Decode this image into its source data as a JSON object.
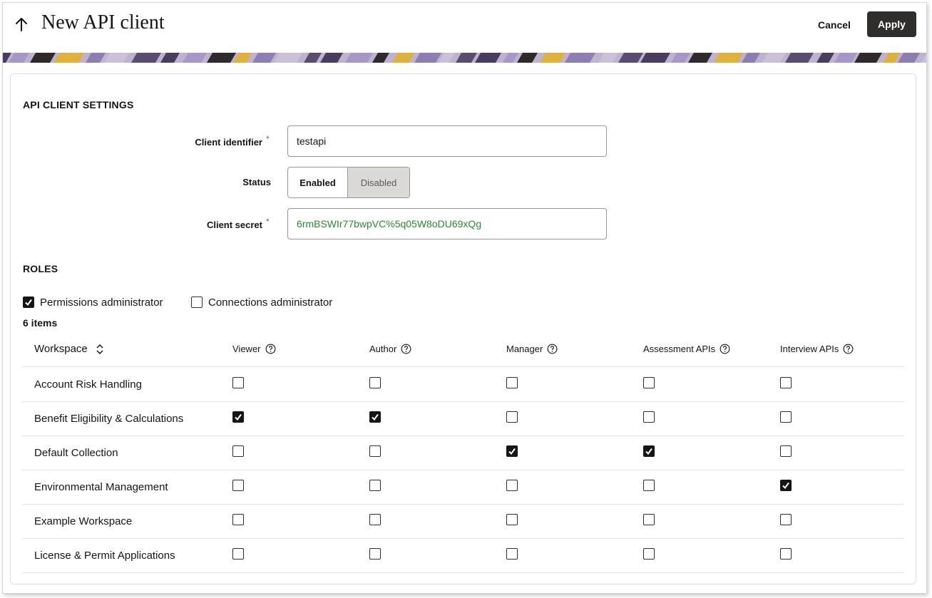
{
  "header": {
    "title": "New API client",
    "cancel_label": "Cancel",
    "apply_label": "Apply",
    "back_icon": "arrow-up-icon"
  },
  "settings": {
    "section_title": "API CLIENT SETTINGS",
    "client_identifier": {
      "label": "Client identifier",
      "required_mark": "*",
      "value": "testapi"
    },
    "status": {
      "label": "Status",
      "options": [
        "Enabled",
        "Disabled"
      ],
      "selected": "Enabled"
    },
    "client_secret": {
      "label": "Client secret",
      "required_mark": "*",
      "value": "6rmBSWIr77bwpVC%5q05W8oDU69xQg"
    }
  },
  "roles": {
    "section_title": "ROLES",
    "permissions_admin": {
      "label": "Permissions administrator",
      "checked": true
    },
    "connections_admin": {
      "label": "Connections administrator",
      "checked": false
    },
    "items_count": "6 items",
    "columns": [
      "Workspace",
      "Viewer",
      "Author",
      "Manager",
      "Assessment APIs",
      "Interview APIs"
    ],
    "rows": [
      {
        "workspace": "Account Risk Handling",
        "checks": [
          false,
          false,
          false,
          false,
          false
        ]
      },
      {
        "workspace": "Benefit Eligibility & Calculations",
        "checks": [
          true,
          true,
          false,
          false,
          false
        ]
      },
      {
        "workspace": "Default Collection",
        "checks": [
          false,
          false,
          true,
          true,
          false
        ]
      },
      {
        "workspace": "Environmental Management",
        "checks": [
          false,
          false,
          false,
          false,
          true
        ]
      },
      {
        "workspace": "Example Workspace",
        "checks": [
          false,
          false,
          false,
          false,
          false
        ]
      },
      {
        "workspace": "License & Permit Applications",
        "checks": [
          false,
          false,
          false,
          false,
          false
        ]
      }
    ]
  },
  "colors": {
    "primary_button": "#312d2a",
    "secret_text": "#2b8a2b",
    "banner_purple": "#a996c9"
  }
}
